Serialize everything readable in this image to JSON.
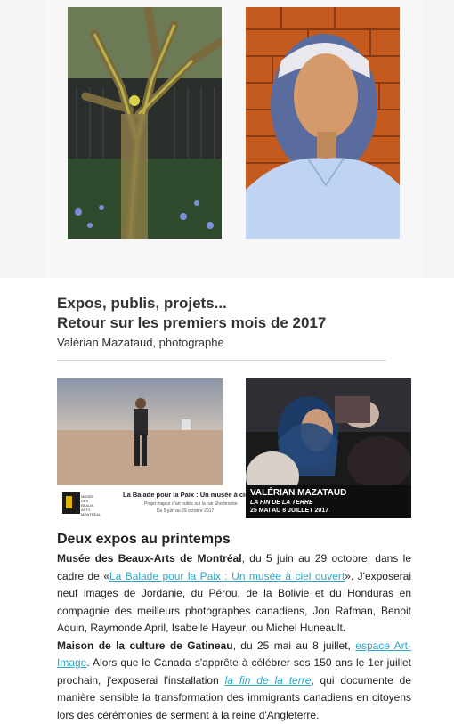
{
  "header": {
    "title_line1": "Expos, publis, projets...",
    "title_line2": "Retour sur les premiers mois de 2017",
    "byline": "Valérian Mazataud, photographe"
  },
  "poster1": {
    "title": "La Balade pour la Paix : Un musée à ciel ouvert",
    "subtitle": "Projet majeur d'art public sur la rue Sherbrooke",
    "dates": "Du 5 juin au 29 octobre 2017",
    "logo_text": "MUSÉE DES BEAUX-ARTS MONTRÉAL"
  },
  "poster2": {
    "name": "VALÉRIAN MAZATAUD",
    "title": "LA FIN DE LA TERRE",
    "dates": "25 MAI AU 8 JUILLET 2017"
  },
  "section": {
    "title": "Deux expos au printemps",
    "p1": {
      "venue": "Musée des Beaux-Arts de Montréal",
      "t1": ", du 5 juin au 29 octobre, dans le cadre de «",
      "link": "La Balade pour la Paix : Un musée à ciel ouvert",
      "t2": "». J'exposerai neuf images de Jordanie, du Pérou, de la Bolivie et du Honduras en compagnie des meilleurs photographes canadiens, Jon Rafman, Benoit Aquin, Raymonde April, Isabelle Hayeur, ou Michel Huneault."
    },
    "p2": {
      "venue": "Maison de la culture de Gatineau",
      "t1": ", du 25 mai au 8 juillet, ",
      "link1": "espace Art-Image",
      "t2": ". Alors que le Canada s'apprête à célébrer ses 150 ans le 1er juillet prochain, j'exposerai l'installation ",
      "link2": "la fin de la terre",
      "t3": ", qui documente de manière sensible la transformation des immigrants canadiens en citoyens lors des cérémonies de serment à la reine d'Angleterre."
    }
  },
  "colors": {
    "link": "#2ba6cb",
    "hero_bg": "#f5f5f5"
  }
}
